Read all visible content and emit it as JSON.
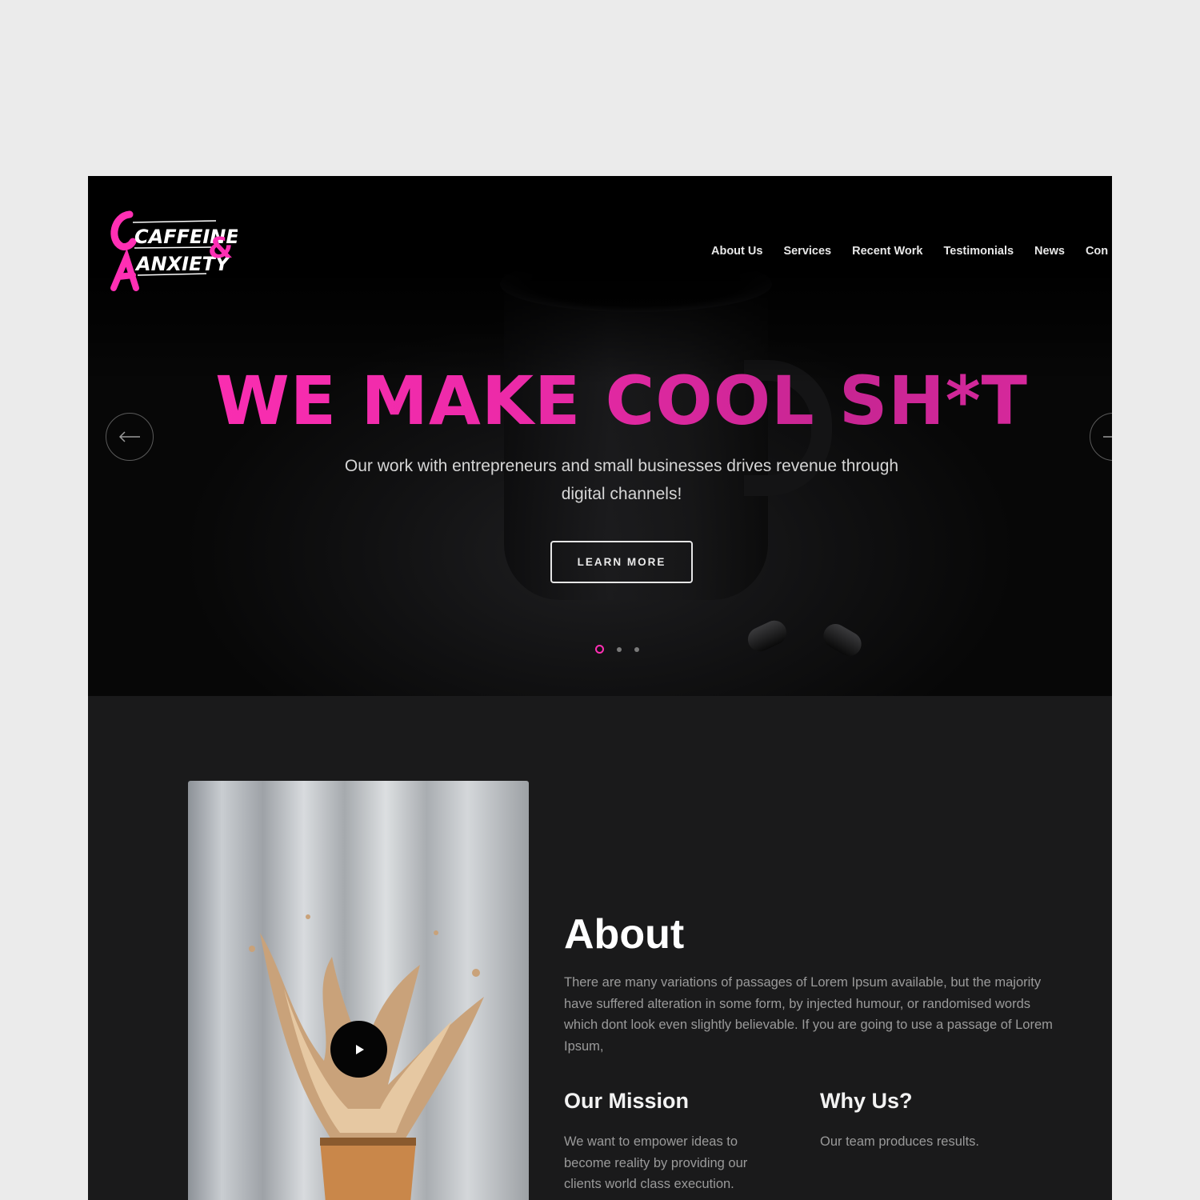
{
  "brand": {
    "logo_line1": "CAFFEINE",
    "logo_line2": "ANXIETY",
    "logo_amp": "&",
    "accent_color": "#ff2fb4"
  },
  "nav": {
    "items": [
      "About Us",
      "Services",
      "Recent Work",
      "Testimonials",
      "News",
      "Con"
    ]
  },
  "hero": {
    "headline": "WE MAKE COOL SH*T",
    "subtitle": "Our work with entrepreneurs and small businesses drives revenue through digital channels!",
    "cta_label": "LEARN MORE",
    "prev_icon": "arrow-left-icon",
    "next_icon": "arrow-right-icon",
    "slide_count": 3,
    "active_slide": 1
  },
  "about": {
    "title": "About",
    "text": "There are many variations of passages of Lorem Ipsum available, but the majority have suffered alteration in some form, by injected humour, or randomised words which dont look even slightly believable. If you are going to use a passage of Lorem Ipsum,",
    "video_icon": "play-icon",
    "mission_title": "Our Mission",
    "mission_text": "We want to empower ideas to become reality by providing our clients world class execution.",
    "why_title": "Why Us?",
    "why_text": "Our team produces results."
  }
}
